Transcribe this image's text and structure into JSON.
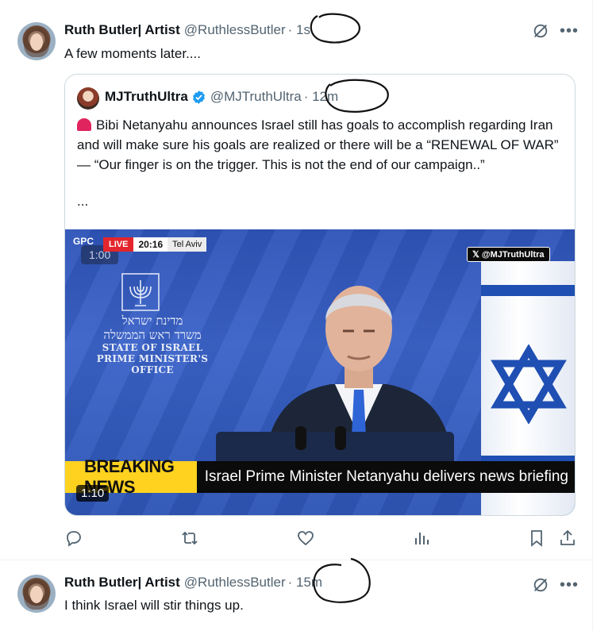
{
  "tweet1": {
    "name": "Ruth Butler| Artist",
    "handle": "@RuthlessButler",
    "time": "· 1s",
    "text": "A few moments later....",
    "quote": {
      "name": "MJTruthUltra",
      "handle": "@MJTruthUltra",
      "time": "· 12m",
      "text": "Bibi Netanyahu announces Israel still has goals to accomplish regarding Iran and will make sure his goals are realized or there will be a “RENEWAL OF WAR” — “Our finger is on the trigger. This is not the end of our campaign..”",
      "ellipsis": "...",
      "video": {
        "gpc": "GPC",
        "top_timer": "1:00",
        "live": "LIVE",
        "clock": "20:16",
        "location": "Tel Aviv",
        "watermark": "@MJTruthUltra",
        "emblem_hebrew_1": "מדינת ישראל",
        "emblem_hebrew_2": "משרד ראש הממשלה",
        "emblem_en_1": "STATE OF ISRAEL",
        "emblem_en_2": "PRIME MINISTER'S OFFICE",
        "breaking": "BREAKING NEWS",
        "headline": "Israel Prime Minister Netanyahu delivers news briefing",
        "duration": "1:10"
      }
    },
    "actions": [
      "reply-icon",
      "retweet-icon",
      "like-icon",
      "views-icon",
      "bookmark-icon",
      "share-icon"
    ]
  },
  "tweet2": {
    "name": "Ruth Butler| Artist",
    "handle": "@RuthlessButler",
    "time": "· 15m",
    "text": "I think Israel will stir things up."
  },
  "colors": {
    "accent": "#1d9bf0",
    "secondary_text": "#536471",
    "border": "#cfd9de",
    "breaking_yellow": "#ffd21f",
    "live_red": "#e3262d"
  }
}
